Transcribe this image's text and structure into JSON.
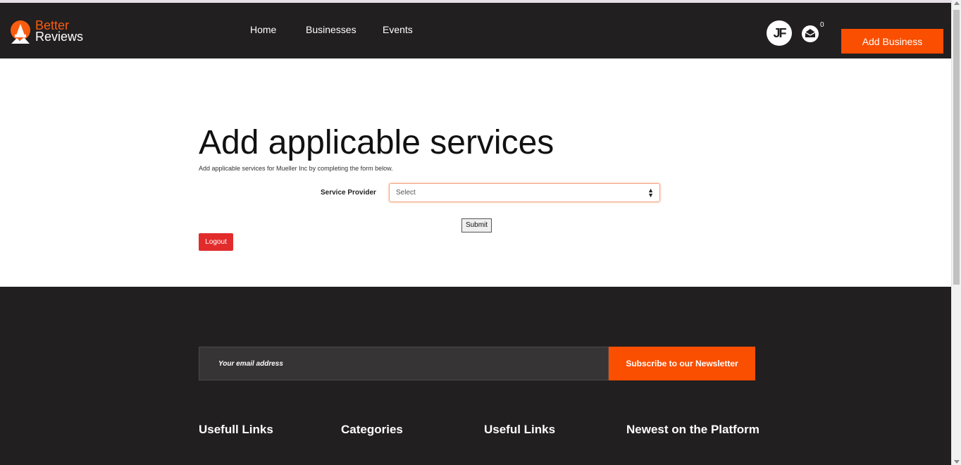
{
  "brand": {
    "line1": "Better",
    "line2": "Reviews",
    "accent": "#fa5c0f"
  },
  "nav": {
    "items": [
      "Home",
      "Businesses",
      "Events"
    ]
  },
  "user": {
    "initials": "JF",
    "mail_count": "0"
  },
  "header": {
    "add_business_label": "Add Business"
  },
  "main": {
    "title": "Add applicable services",
    "subtitle": "Add applicable services for Mueller Inc by completing the form below.",
    "service_provider_label": "Service Provider",
    "select_value": "Select",
    "submit_label": "Submit",
    "logout_label": "Logout"
  },
  "footer": {
    "email_placeholder": "Your email address",
    "subscribe_label": "Subscribe to our Newsletter",
    "headings": [
      "Usefull Links",
      "Categories",
      "Useful Links",
      "Newest on the Platform"
    ]
  },
  "colors": {
    "dark": "#211f20",
    "orange": "#fa4e00",
    "logout_red": "#e22c2c"
  }
}
